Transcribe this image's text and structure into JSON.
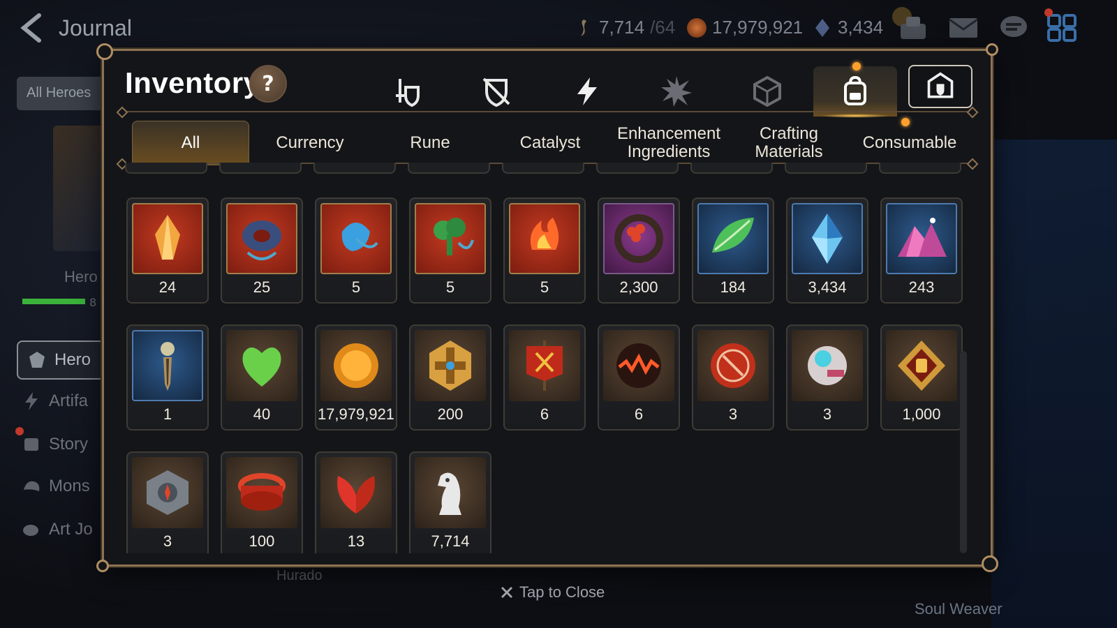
{
  "header": {
    "title": "Journal",
    "resources": [
      {
        "icon": "stamina-icon",
        "value": "7,714",
        "sub": "/64"
      },
      {
        "icon": "gold-icon",
        "value": "17,979,921",
        "sub": ""
      },
      {
        "icon": "skystone-icon",
        "value": "3,434",
        "sub": ""
      }
    ]
  },
  "left": {
    "filter_label": "All Heroes",
    "hero_label": "Hero",
    "hero_progress_text": "8",
    "nav_items": [
      {
        "label": "Hero",
        "icon": "hero-icon"
      },
      {
        "label": "Artifa",
        "icon": "artifact-icon"
      },
      {
        "label": "Story",
        "icon": "story-icon"
      },
      {
        "label": "Mons",
        "icon": "monster-icon"
      },
      {
        "label": "Art Jo",
        "icon": "art-journal-icon"
      }
    ]
  },
  "inventory": {
    "title": "Inventory",
    "help_label": "?",
    "category_tabs": [
      {
        "icon": "equipment-sword-shield-icon"
      },
      {
        "icon": "crossed-swords-shield-icon"
      },
      {
        "icon": "lightning-icon"
      },
      {
        "icon": "explosion-icon"
      },
      {
        "icon": "cube-icon"
      },
      {
        "icon": "backpack-icon",
        "selected": true
      },
      {
        "icon": "guild-emblem-icon"
      }
    ],
    "sub_tabs": [
      "All",
      "Currency",
      "Rune",
      "Catalyst",
      "Enhancement Ingredients",
      "Crafting Materials",
      "Consumable"
    ],
    "items_row1": [
      {
        "icon": "orange-crystal-rune-icon",
        "qty": "24",
        "frame": "red"
      },
      {
        "icon": "blue-pink-ring-pendant-icon",
        "qty": "25",
        "frame": "red"
      },
      {
        "icon": "blue-teardrop-pendant-icon",
        "qty": "5",
        "frame": "red"
      },
      {
        "icon": "green-tree-pendant-icon",
        "qty": "5",
        "frame": "red"
      },
      {
        "icon": "flame-pendant-icon",
        "qty": "5",
        "frame": "red"
      },
      {
        "icon": "red-flower-bracelet-icon",
        "qty": "2,300",
        "frame": "purple"
      },
      {
        "icon": "green-leaf-icon",
        "qty": "184",
        "frame": "blue"
      },
      {
        "icon": "blue-crystal-icon",
        "qty": "3,434",
        "frame": "blue"
      },
      {
        "icon": "pink-mountain-crystal-icon",
        "qty": "243",
        "frame": "blue"
      }
    ],
    "items_row2": [
      {
        "icon": "dagger-pendant-icon",
        "qty": "1",
        "frame": "blue"
      },
      {
        "icon": "green-heart-icon",
        "qty": "40",
        "frame": "brown"
      },
      {
        "icon": "gold-sun-coin-icon",
        "qty": "17,979,921",
        "frame": "brown"
      },
      {
        "icon": "gold-hexagon-cross-icon",
        "qty": "200",
        "frame": "brown"
      },
      {
        "icon": "red-banner-icon",
        "qty": "6",
        "frame": "brown"
      },
      {
        "icon": "lava-orb-icon",
        "qty": "6",
        "frame": "brown"
      },
      {
        "icon": "red-seal-coin-icon",
        "qty": "3",
        "frame": "brown"
      },
      {
        "icon": "mechanical-device-icon",
        "qty": "3",
        "frame": "brown"
      },
      {
        "icon": "fist-emblem-icon",
        "qty": "1,000",
        "frame": "brown"
      }
    ],
    "items_row3": [
      {
        "icon": "stone-compass-icon",
        "qty": "3",
        "frame": "brown"
      },
      {
        "icon": "red-ring-band-icon",
        "qty": "100",
        "frame": "brown"
      },
      {
        "icon": "red-split-leaf-icon",
        "qty": "13",
        "frame": "brown"
      },
      {
        "icon": "silver-chess-knight-icon",
        "qty": "7,714",
        "frame": "brown"
      }
    ],
    "close_label": "Tap to Close"
  },
  "background": {
    "bottom_label": "Hurado",
    "right_label": "Soul Weaver"
  },
  "colors": {
    "accent_gold": "#8d7353",
    "tab_glow": "#ffc85a",
    "notify_dot": "#ff9f2c"
  }
}
